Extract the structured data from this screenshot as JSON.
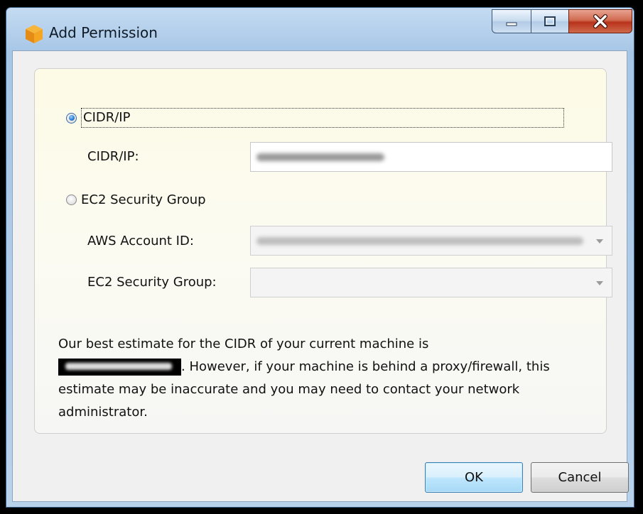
{
  "window": {
    "title": "Add Permission",
    "icon": "aws-cube-icon"
  },
  "title_buttons": {
    "minimize_icon": "minimize-icon",
    "maximize_icon": "maximize-icon",
    "close_icon": "close-icon"
  },
  "options": {
    "cidr_ip_label": "CIDR/IP",
    "cidr_ip_selected": true,
    "ec2_group_label": "EC2 Security Group",
    "ec2_group_selected": false
  },
  "fields": {
    "cidr_ip_label": "CIDR/IP:",
    "aws_account_label": "AWS Account ID:",
    "ec2_group_label": "EC2 Security Group:"
  },
  "info": {
    "text_before": "Our best estimate for the CIDR of your current machine is",
    "text_after": ". However, if your machine is behind a proxy/firewall, this estimate may be inaccurate and you may need to contact your network administrator."
  },
  "buttons": {
    "ok": "OK",
    "cancel": "Cancel"
  },
  "colors": {
    "accent_blue": "#3c7fb1",
    "close_red": "#b8321b",
    "panel_bg": "#fdfbe6"
  }
}
